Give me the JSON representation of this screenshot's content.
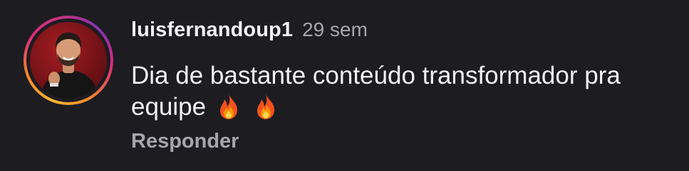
{
  "comment": {
    "username": "luisfernandoup1",
    "time": "29 sem",
    "text": "Dia de bastante conteúdo transformador pra equipe",
    "emojis": [
      "fire-emoji",
      "fire-emoji"
    ],
    "reply_label": "Responder"
  },
  "colors": {
    "background": "#1c1c21",
    "primary_text": "#f3f3f5",
    "secondary_text": "#a6a6ad",
    "story_ring": [
      "#f9b52e",
      "#f58529",
      "#dd2a7b",
      "#8134af"
    ]
  }
}
